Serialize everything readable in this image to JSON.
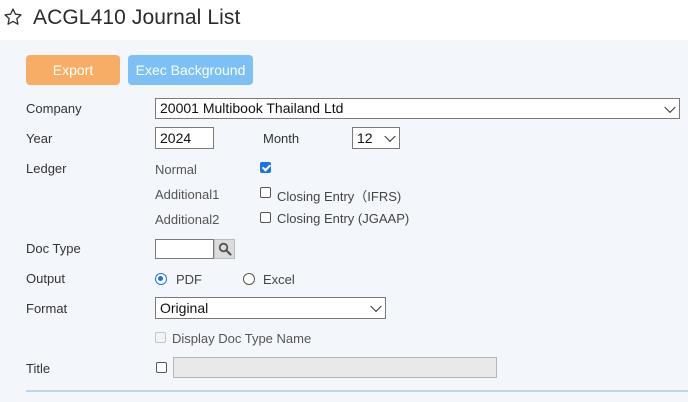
{
  "header": {
    "title": "ACGL410 Journal List",
    "favorite_icon": "star-outline-icon"
  },
  "toolbar": {
    "export_label": "Export",
    "exec_label": "Exec Background",
    "export_color": "#f8ad67",
    "exec_color": "#7cc0f5"
  },
  "form": {
    "company": {
      "label": "Company",
      "value": "20001 Multibook Thailand Ltd"
    },
    "year": {
      "label": "Year",
      "value": "2024"
    },
    "month": {
      "label": "Month",
      "value": "12"
    },
    "ledger": {
      "label": "Ledger",
      "normal_label": "Normal",
      "normal_checked": true,
      "additional1_label": "Additional1",
      "closing_ifrs_label": "Closing Entry（IFRS)",
      "closing_ifrs_checked": false,
      "additional2_label": "Additional2",
      "closing_jgaap_label": "Closing Entry (JGAAP)",
      "closing_jgaap_checked": false
    },
    "doc_type": {
      "label": "Doc Type",
      "value": "",
      "search_icon": "magnifier-icon"
    },
    "output": {
      "label": "Output",
      "pdf_label": "PDF",
      "excel_label": "Excel",
      "selected": "PDF"
    },
    "format": {
      "label": "Format",
      "value": "Original",
      "display_doc_type_label": "Display Doc Type Name",
      "display_doc_type_checked": false,
      "display_doc_type_disabled": true
    },
    "title": {
      "label": "Title",
      "checked": false,
      "value": ""
    }
  },
  "colors": {
    "panel_bg": "#f3f6fa",
    "accent": "#1a73e8"
  }
}
